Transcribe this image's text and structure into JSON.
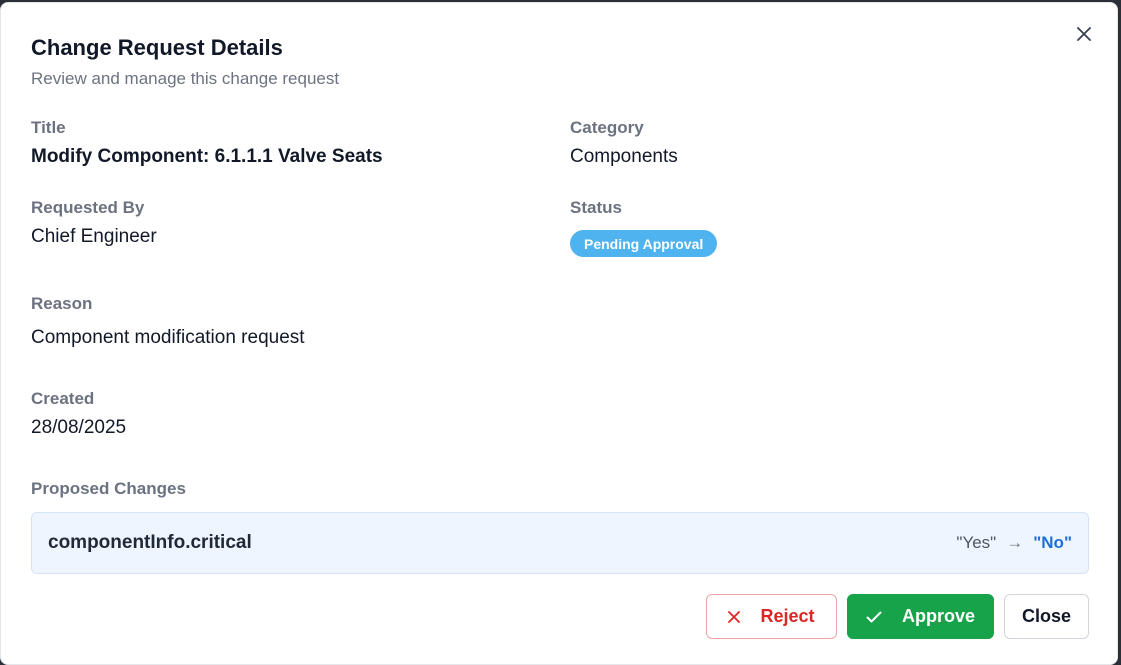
{
  "dialog": {
    "title": "Change Request Details",
    "subtitle": "Review and manage this change request",
    "close_icon": "close-icon"
  },
  "fields": {
    "title_label": "Title",
    "title_value": "Modify Component: 6.1.1.1 Valve Seats",
    "category_label": "Category",
    "category_value": "Components",
    "requested_by_label": "Requested By",
    "requested_by_value": "Chief Engineer",
    "status_label": "Status",
    "status_value": "Pending Approval",
    "reason_label": "Reason",
    "reason_value": "Component modification request",
    "created_label": "Created",
    "created_value": "28/08/2025"
  },
  "proposed_changes": {
    "label": "Proposed Changes",
    "items": [
      {
        "field": "componentInfo.critical",
        "old_value": "\"Yes\"",
        "arrow": "→",
        "new_value": "\"No\""
      }
    ]
  },
  "actions": {
    "reject_label": "Reject",
    "approve_label": "Approve",
    "close_label": "Close"
  },
  "colors": {
    "status_badge": "#4fb3f0",
    "approve": "#16a34a",
    "reject": "#dc2626",
    "new_value": "#1d6fd8"
  }
}
